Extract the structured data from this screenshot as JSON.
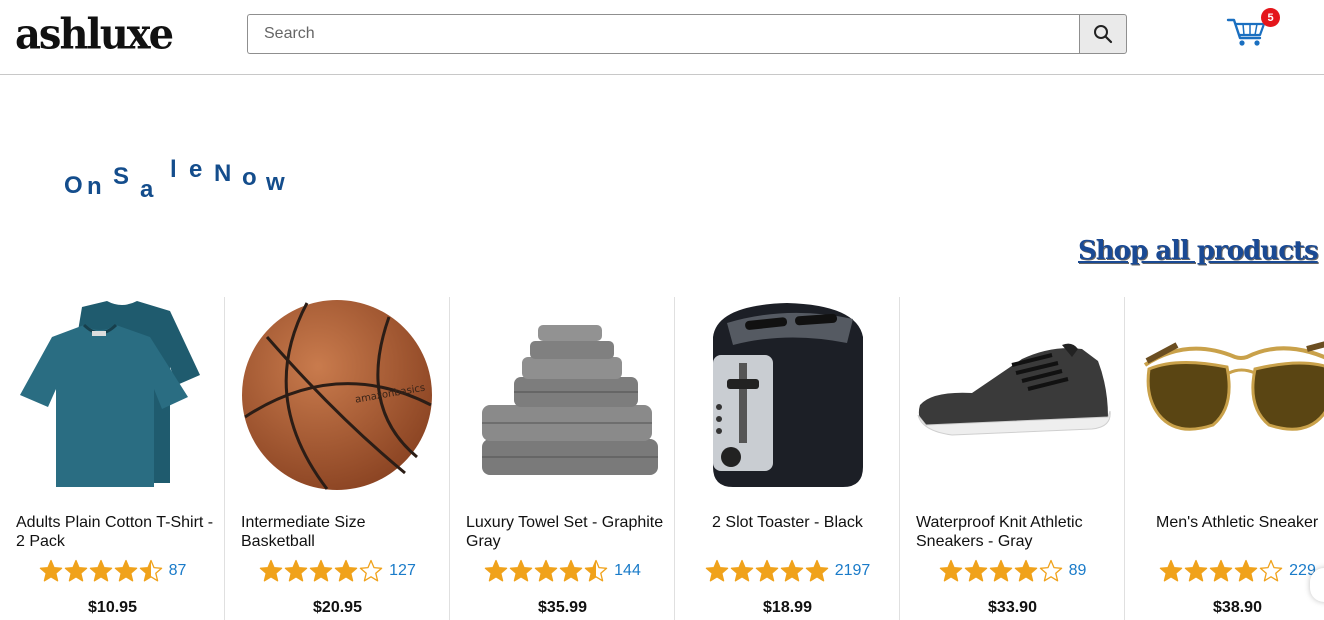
{
  "header": {
    "logo_text": "ashluxe",
    "search": {
      "placeholder": "Search",
      "value": ""
    },
    "cart": {
      "count": "5"
    }
  },
  "promo": {
    "letters": [
      "O",
      "n",
      "S",
      "a",
      "l",
      "e",
      "N",
      "o",
      "w"
    ],
    "shop_all_label": "Shop all products"
  },
  "products": [
    {
      "name": "Adults Plain Cotton T-Shirt - 2 Pack",
      "rating": 4.5,
      "reviews": "87",
      "price": "$10.95",
      "image": "tshirt"
    },
    {
      "name": "Intermediate Size Basketball",
      "rating": 4,
      "reviews": "127",
      "price": "$20.95",
      "image": "basketball"
    },
    {
      "name": "Luxury Towel Set - Graphite Gray",
      "rating": 4.5,
      "reviews": "144",
      "price": "$35.99",
      "image": "towels"
    },
    {
      "name": "2 Slot Toaster - Black",
      "rating": 5,
      "reviews": "2197",
      "price": "$18.99",
      "image": "toaster"
    },
    {
      "name": "Waterproof Knit Athletic Sneakers - Gray",
      "rating": 4,
      "reviews": "89",
      "price": "$33.90",
      "image": "sneaker"
    },
    {
      "name": "Men's Athletic Sneaker",
      "rating": 4,
      "reviews": "229",
      "price": "$38.90",
      "image": "sunglasses"
    }
  ],
  "colors": {
    "accent": "#144d8c",
    "star": "#f0a21b",
    "badge": "#e4161b",
    "link": "#1a7bc9"
  }
}
